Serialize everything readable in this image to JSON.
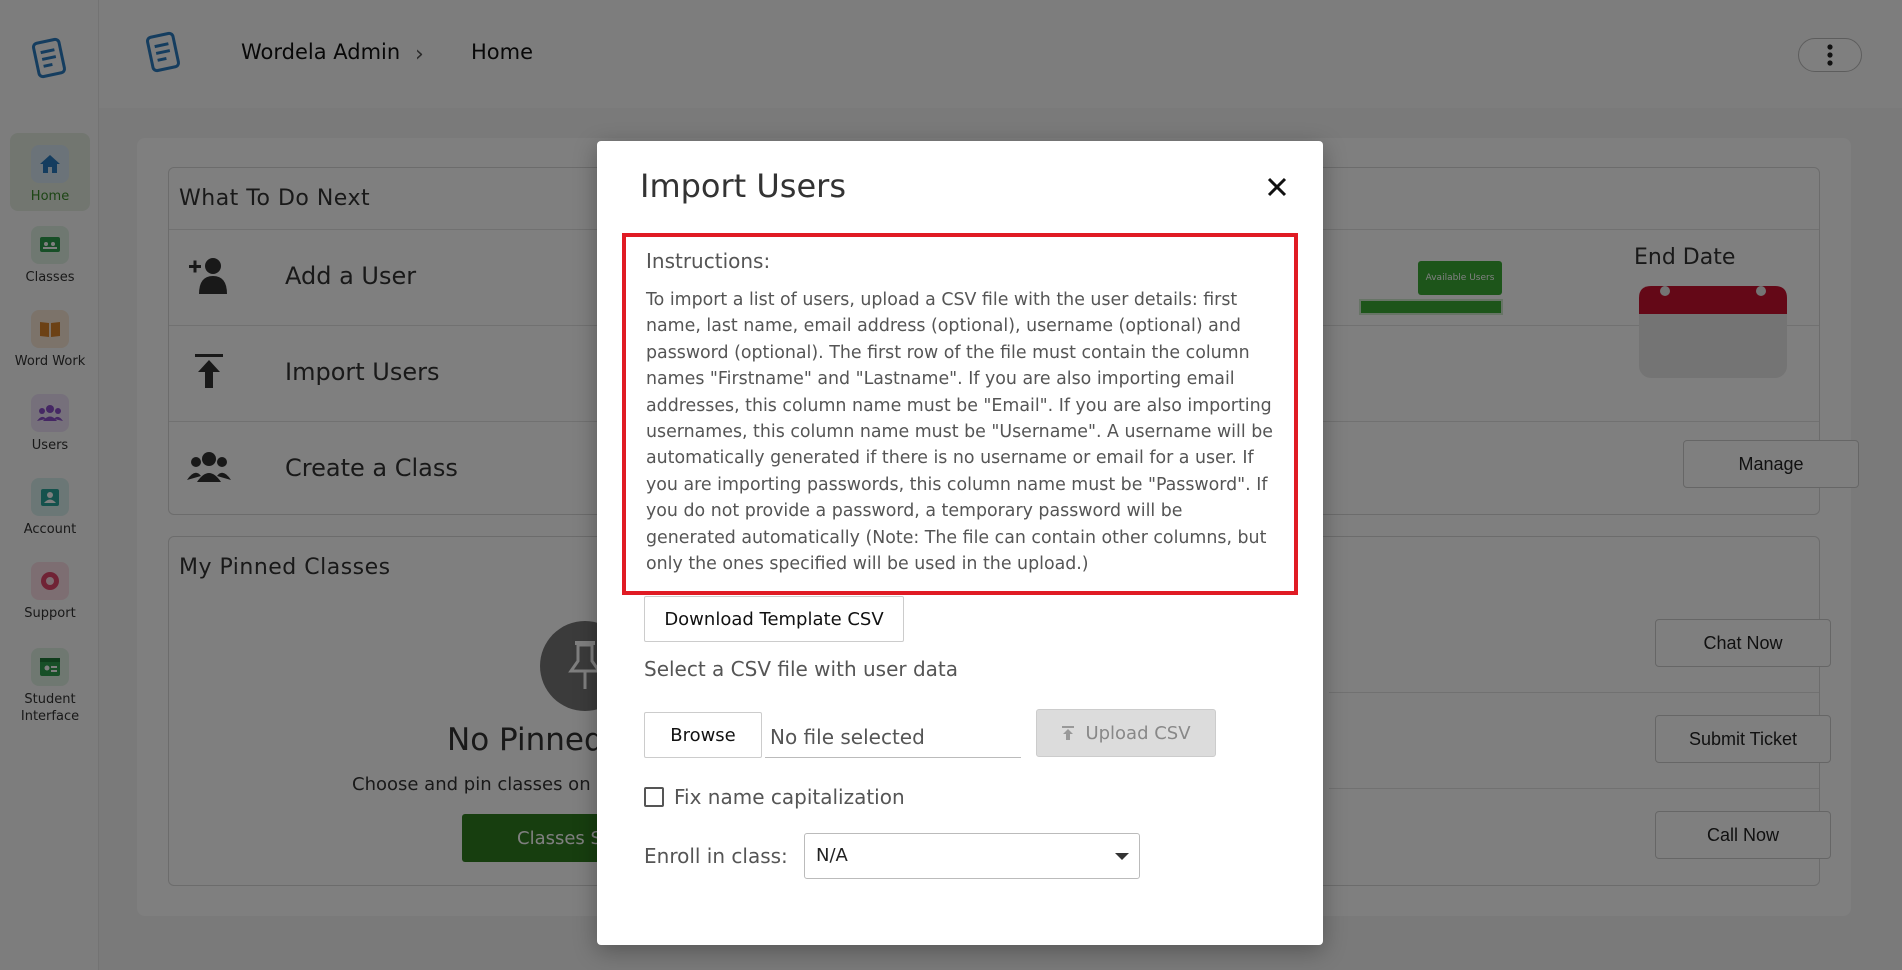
{
  "sidebar": {
    "items": [
      {
        "label": "Home",
        "icon": "home-icon",
        "color": "#2a7bbf",
        "active": true
      },
      {
        "label": "Classes",
        "icon": "classes-icon",
        "color": "#2e9e4f"
      },
      {
        "label": "Word Work",
        "icon": "book-icon",
        "color": "#d9822b"
      },
      {
        "label": "Users",
        "icon": "users-icon",
        "color": "#8a4fc9"
      },
      {
        "label": "Account",
        "icon": "account-icon",
        "color": "#2ba59b"
      },
      {
        "label": "Support",
        "icon": "support-icon",
        "color": "#e0466b"
      },
      {
        "label": "Student Interface",
        "icon": "student-interface-icon",
        "color": "#2e9e4f"
      }
    ]
  },
  "header": {
    "crumb1": "Wordela Admin",
    "crumb2": "Home"
  },
  "main": {
    "what_next": {
      "title": "What To Do Next",
      "items": [
        "Add a User",
        "Import Users",
        "Create a Class"
      ]
    },
    "chart_badge": "Available Users",
    "end_date_label": "End Date",
    "manage_label": "Manage",
    "pinned": {
      "title": "My Pinned Classes",
      "empty_title": "No Pinned",
      "empty_sub": "Choose and pin classes on",
      "button": "Classes S"
    },
    "support_buttons": [
      "Chat Now",
      "Submit Ticket",
      "Call Now"
    ]
  },
  "modal": {
    "title": "Import Users",
    "instructions_heading": "Instructions:",
    "instructions_text": "To import a list of users, upload a CSV file with the user details: first name, last name, email address (optional), username (optional) and password (optional). The first row of the file must contain the column names \"Firstname\" and \"Lastname\". If you are also importing email addresses, this column name must be \"Email\". If you are also importing usernames, this column name must be \"Username\". A username will be automatically generated if there is no username or email for a user. If you are importing passwords, this column name must be \"Password\". If you do not provide a password, a temporary password will be generated automatically (Note: The file can contain other columns, but only the ones specified will be used in the upload.)",
    "download_label": "Download Template CSV",
    "select_label": "Select a CSV file with user data",
    "browse_label": "Browse",
    "file_status": "No file selected",
    "upload_label": "Upload CSV",
    "fix_caps_label": "Fix name capitalization",
    "fix_caps_checked": false,
    "enroll_label": "Enroll in class:",
    "enroll_value": "N/A"
  },
  "colors": {
    "highlight": "#e01b24",
    "brand_blue": "#2a7bbf",
    "brand_green": "#2e7d1f",
    "calendar_red": "#c8102e"
  }
}
